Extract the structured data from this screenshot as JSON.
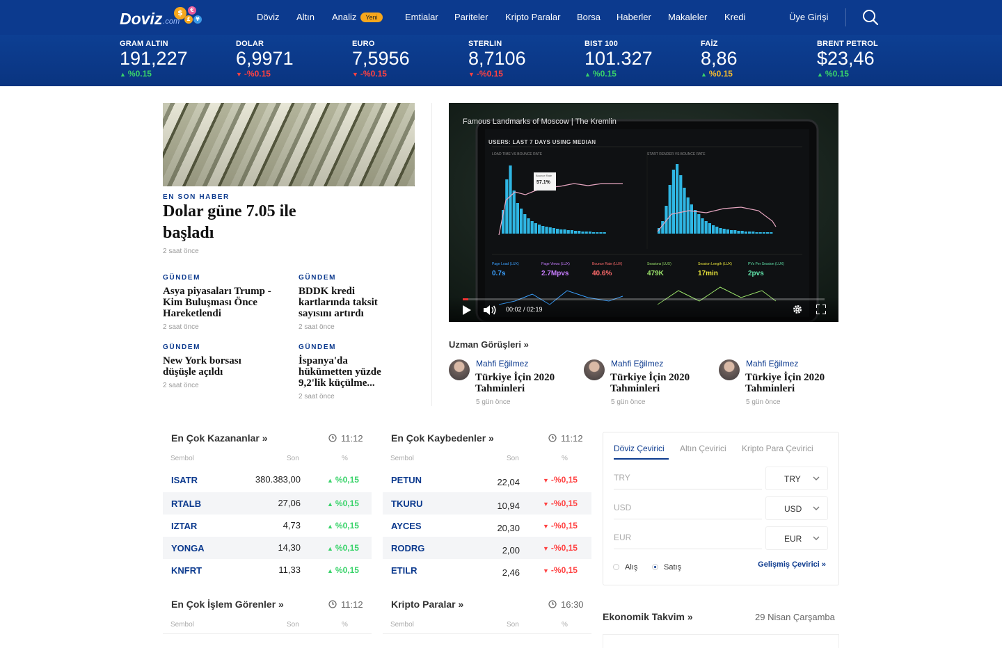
{
  "brand": {
    "name": "Doviz",
    "suffix": ".com",
    "coins": [
      "$",
      "€",
      "£",
      "¥"
    ]
  },
  "nav": {
    "items": [
      {
        "label": "Döviz"
      },
      {
        "label": "Altın"
      },
      {
        "label": "Analiz",
        "badge": "Yeni"
      },
      {
        "label": "Emtialar"
      },
      {
        "label": "Pariteler"
      },
      {
        "label": "Kripto Paralar"
      },
      {
        "label": "Borsa"
      },
      {
        "label": "Haberler"
      },
      {
        "label": "Makaleler"
      },
      {
        "label": "Kredi"
      }
    ],
    "login": "Üye Girişi",
    "search_icon": "search-icon"
  },
  "ticker": [
    {
      "name": "GRAM ALTIN",
      "value": "191,227",
      "change": "%0.15",
      "direction": "up",
      "color": "#39d36a"
    },
    {
      "name": "DOLAR",
      "value": "6,9971",
      "change": "-%0.15",
      "direction": "down",
      "color": "#ff4141"
    },
    {
      "name": "EURO",
      "value": "7,5956",
      "change": "-%0.15",
      "direction": "down",
      "color": "#ff4141"
    },
    {
      "name": "STERLIN",
      "value": "8,7106",
      "change": "-%0.15",
      "direction": "down",
      "color": "#ff4141"
    },
    {
      "name": "BIST 100",
      "value": "101.327",
      "change": "%0.15",
      "direction": "up",
      "color": "#39d36a"
    },
    {
      "name": "FAİZ",
      "value": "8,86",
      "change": "%0.15",
      "direction": "up",
      "color": "#f2b92f"
    },
    {
      "name": "BRENT PETROL",
      "value": "$23,46",
      "change": "%0.15",
      "direction": "up",
      "color": "#39d36a"
    }
  ],
  "headline": {
    "category": "EN SON HABER",
    "title": "Dolar güne 7.05 ile başladı",
    "time": "2 saat önce"
  },
  "news": [
    {
      "category": "GÜNDEM",
      "title": "Asya piyasaları Trump - Kim Buluşması Önce Hareketlendi",
      "time": "2 saat önce"
    },
    {
      "category": "GÜNDEM",
      "title": "BDDK kredi kartlarında taksit sayısını artırdı",
      "time": "2 saat önce"
    },
    {
      "category": "GÜNDEM",
      "title": "New York borsası düşüşle açıldı",
      "time": "2 saat önce"
    },
    {
      "category": "GÜNDEM",
      "title": "İspanya'da hükümetten yüzde 9,2'lik küçülme...",
      "time": "2 saat önce"
    }
  ],
  "video": {
    "title": "Famous Landmarks of Moscow | The Kremlin",
    "time": "00:02 / 02:19",
    "progress": 0.015,
    "screen": {
      "heading": "USERS: LAST 7 DAYS USING MEDIAN",
      "chart_left": "LOAD TIME VS BOUNCE RATE",
      "chart_right": "START RENDER VS BOUNCE RATE",
      "tooltip_label": "Bounce Rate",
      "tooltip_value": "57.1%",
      "metrics": [
        {
          "label": "Page Load (LUX)",
          "value": "0.7s",
          "color": "#3aa0ff"
        },
        {
          "label": "Page Views (LUX)",
          "value": "2.7Mpvs",
          "color": "#c77dff"
        },
        {
          "label": "Bounce Rate (LUX)",
          "value": "40.6%",
          "color": "#ff6b6b"
        },
        {
          "label": "Sessions (LUX)",
          "value": "479K",
          "color": "#9be36a"
        },
        {
          "label": "Session Length (LUX)",
          "value": "17min",
          "color": "#e6e23a"
        },
        {
          "label": "PVs Per Session (LUX)",
          "value": "2pvs",
          "color": "#5fe0a8"
        }
      ]
    }
  },
  "experts": {
    "heading": "Uzman Görüşleri »",
    "items": [
      {
        "author": "Mahfi Eğilmez",
        "title": "Türkiye İçin 2020 Tahminleri",
        "time": "5 gün önce"
      },
      {
        "author": "Mahfi Eğilmez",
        "title": "Türkiye İçin 2020 Tahminleri",
        "time": "5 gün önce"
      },
      {
        "author": "Mahfi Eğilmez",
        "title": "Türkiye İçin 2020 Tahminleri",
        "time": "5 gün önce"
      }
    ]
  },
  "gainers": {
    "title": "En Çok Kazananlar  »",
    "time": "11:12",
    "cols": [
      "Sembol",
      "Son",
      "%"
    ],
    "rows": [
      {
        "sym": "ISATR",
        "val": "380.383,00",
        "chg": "%0,15"
      },
      {
        "sym": "RTALB",
        "val": "27,06",
        "chg": "%0,15"
      },
      {
        "sym": "IZTAR",
        "val": "4,73",
        "chg": "%0,15"
      },
      {
        "sym": "YONGA",
        "val": "14,30",
        "chg": "%0,15"
      },
      {
        "sym": "KNFRT",
        "val": "11,33",
        "chg": "%0,15"
      }
    ]
  },
  "losers": {
    "title": "En Çok Kaybedenler  »",
    "time": "11:12",
    "cols": [
      "Sembol",
      "Son",
      "%"
    ],
    "rows": [
      {
        "sym": "PETUN",
        "val": "22,04",
        "chg": "-%0,15"
      },
      {
        "sym": "TKURU",
        "val": "10,94",
        "chg": "-%0,15"
      },
      {
        "sym": "AYCES",
        "val": "20,30",
        "chg": "-%0,15"
      },
      {
        "sym": "RODRG",
        "val": "2,00",
        "chg": "-%0,15"
      },
      {
        "sym": "ETILR",
        "val": "2,46",
        "chg": "-%0,15"
      }
    ]
  },
  "most_traded": {
    "title": "En Çok İşlem Görenler  »",
    "time": "11:12",
    "cols": [
      "Sembol",
      "Son",
      "%"
    ]
  },
  "crypto": {
    "title": "Kripto Paralar  »",
    "time": "16:30",
    "cols": [
      "Sembol",
      "Son",
      "%"
    ]
  },
  "converter": {
    "tabs": [
      "Döviz Çevirici",
      "Altın Çevirici",
      "Kripto Para Çevirici"
    ],
    "active_tab": 0,
    "rows": [
      {
        "placeholder": "TRY",
        "currency": "TRY"
      },
      {
        "placeholder": "USD",
        "currency": "USD"
      },
      {
        "placeholder": "EUR",
        "currency": "EUR"
      }
    ],
    "radio_buy": "Alış",
    "radio_sell": "Satış",
    "selected": "Satış",
    "advanced": "Gelişmiş Çevirici »"
  },
  "calendar": {
    "title": "Ekonomik Takvim »",
    "date": "29 Nisan Çarşamba"
  },
  "colors": {
    "nav": "#0c3a8e",
    "up": "#39d36a",
    "down": "#ff4141",
    "accent": "#f6a71d"
  }
}
